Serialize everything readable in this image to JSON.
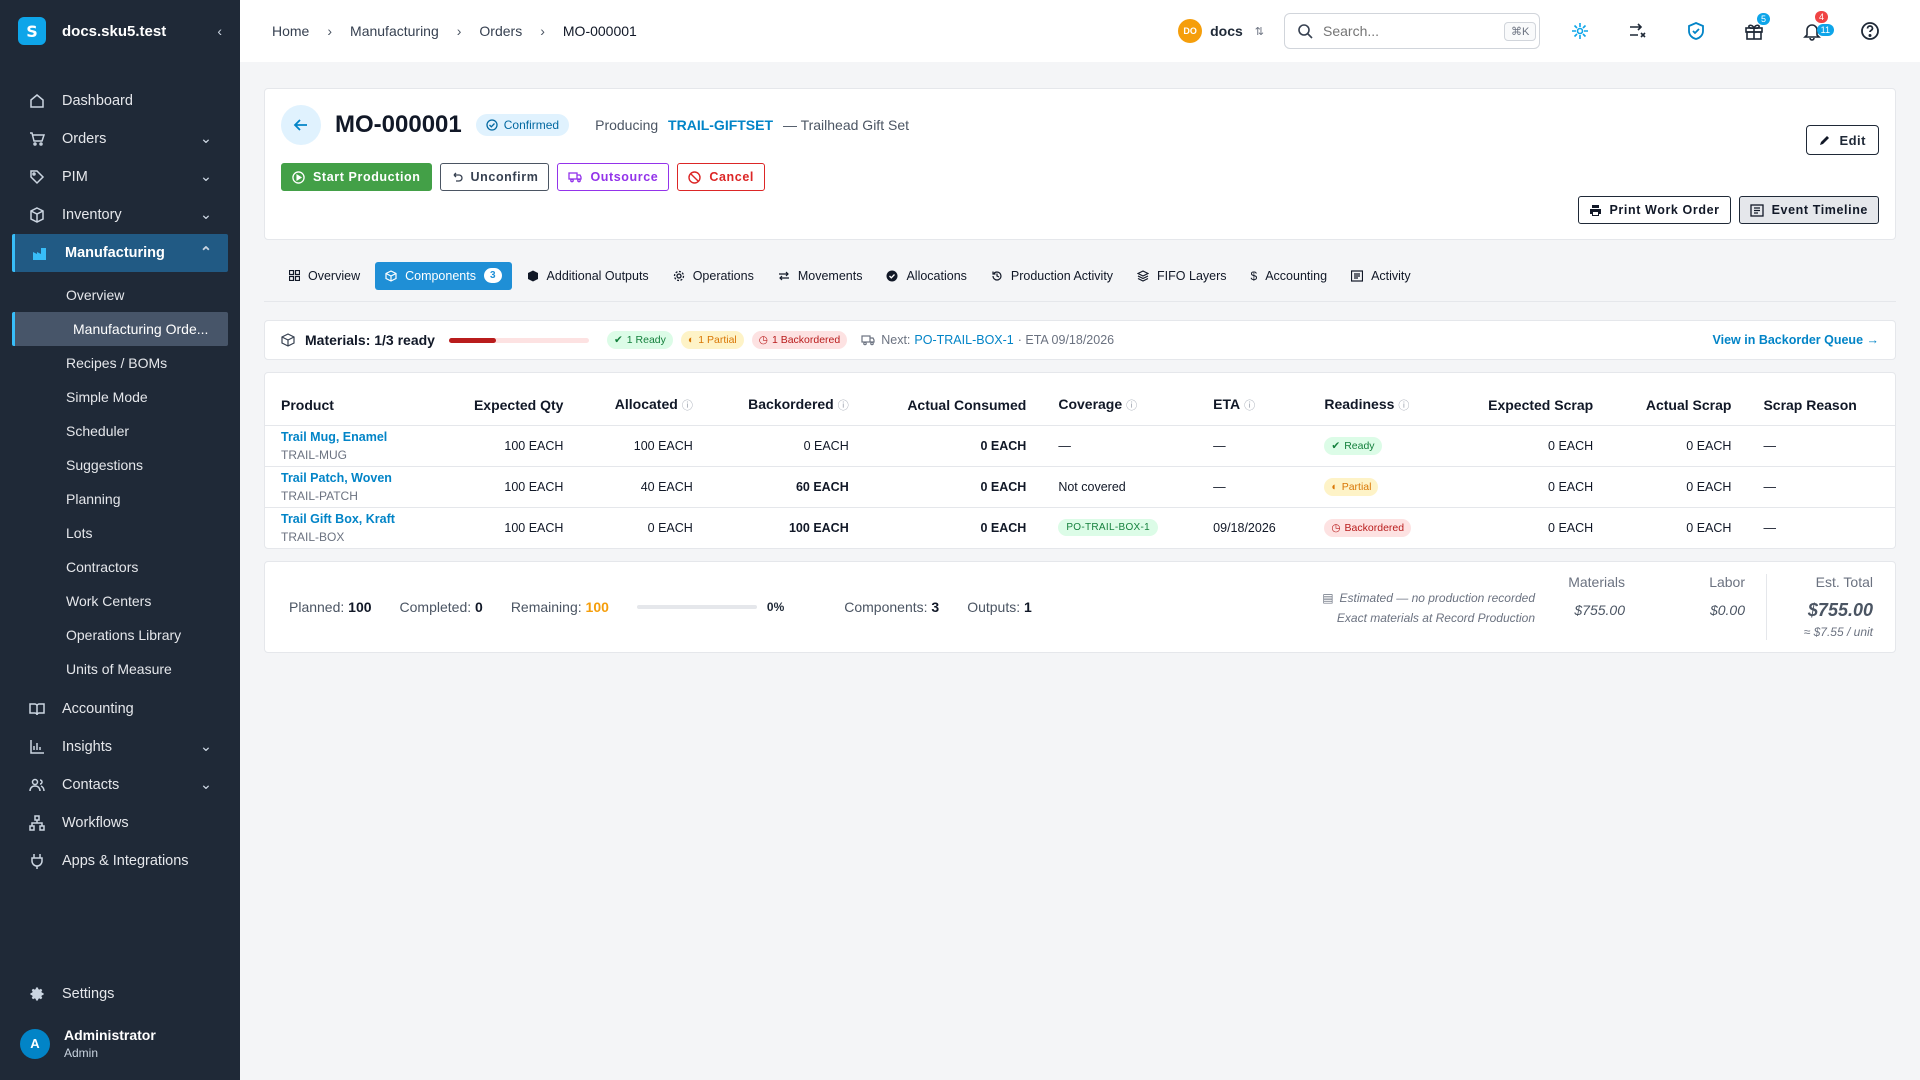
{
  "brand": {
    "name": "docs.sku5.test"
  },
  "sidebar": {
    "items": [
      {
        "label": "Dashboard"
      },
      {
        "label": "Orders"
      },
      {
        "label": "PIM"
      },
      {
        "label": "Inventory"
      },
      {
        "label": "Manufacturing"
      },
      {
        "label": "Accounting"
      },
      {
        "label": "Insights"
      },
      {
        "label": "Contacts"
      },
      {
        "label": "Workflows"
      },
      {
        "label": "Apps & Integrations"
      }
    ],
    "sub_items": [
      {
        "label": "Overview"
      },
      {
        "label": "Manufacturing Orde..."
      },
      {
        "label": "Recipes / BOMs"
      },
      {
        "label": "Simple Mode"
      },
      {
        "label": "Scheduler"
      },
      {
        "label": "Suggestions"
      },
      {
        "label": "Planning"
      },
      {
        "label": "Lots"
      },
      {
        "label": "Contractors"
      },
      {
        "label": "Work Centers"
      },
      {
        "label": "Operations Library"
      },
      {
        "label": "Units of Measure"
      }
    ],
    "settings_label": "Settings",
    "user": {
      "initial": "A",
      "name": "Administrator",
      "role": "Admin"
    }
  },
  "topbar": {
    "breadcrumbs": [
      "Home",
      "Manufacturing",
      "Orders",
      "MO-000001"
    ],
    "org": {
      "initials": "DO",
      "name": "docs"
    },
    "search": {
      "placeholder": "Search...",
      "shortcut": "⌘K"
    },
    "badges": {
      "gift": "5",
      "notif_red": "4",
      "notif_blue": "11"
    }
  },
  "header": {
    "title": "MO-000001",
    "status": "Confirmed",
    "producing_label": "Producing",
    "sku": "TRAIL-GIFTSET",
    "product_name": "— Trailhead Gift Set",
    "edit_label": "Edit",
    "actions": {
      "start": "Start Production",
      "unconfirm": "Unconfirm",
      "outsource": "Outsource",
      "cancel": "Cancel",
      "print": "Print Work Order",
      "timeline": "Event Timeline"
    }
  },
  "tabs": [
    {
      "label": "Overview"
    },
    {
      "label": "Components",
      "count": "3"
    },
    {
      "label": "Additional Outputs"
    },
    {
      "label": "Operations"
    },
    {
      "label": "Movements"
    },
    {
      "label": "Allocations"
    },
    {
      "label": "Production Activity"
    },
    {
      "label": "FIFO Layers"
    },
    {
      "label": "Accounting"
    },
    {
      "label": "Activity"
    }
  ],
  "materials": {
    "label": "Materials: 1/3 ready",
    "ready_fraction": 0.333,
    "chips": {
      "ready": "1 Ready",
      "partial": "1 Partial",
      "backordered": "1 Backordered"
    },
    "next_label": "Next:",
    "next_po": "PO-TRAIL-BOX-1",
    "next_eta": "· ETA 09/18/2026",
    "view_link": "View in Backorder Queue →"
  },
  "table": {
    "columns": [
      "Product",
      "Expected Qty",
      "Allocated",
      "Backordered",
      "Actual Consumed",
      "Coverage",
      "ETA",
      "Readiness",
      "Expected Scrap",
      "Actual Scrap",
      "Scrap Reason"
    ],
    "rows": [
      {
        "name": "Trail Mug, Enamel",
        "sku": "TRAIL-MUG",
        "expected": "100 EACH",
        "allocated": "100 EACH",
        "backordered": "0 EACH",
        "consumed": "0 EACH",
        "coverage": "—",
        "eta": "—",
        "readiness": "Ready",
        "exp_scrap": "0 EACH",
        "act_scrap": "0 EACH",
        "reason": "—"
      },
      {
        "name": "Trail Patch, Woven",
        "sku": "TRAIL-PATCH",
        "expected": "100 EACH",
        "allocated": "40 EACH",
        "backordered": "60 EACH",
        "consumed": "0 EACH",
        "coverage": "Not covered",
        "eta": "—",
        "readiness": "Partial",
        "exp_scrap": "0 EACH",
        "act_scrap": "0 EACH",
        "reason": "—"
      },
      {
        "name": "Trail Gift Box, Kraft",
        "sku": "TRAIL-BOX",
        "expected": "100 EACH",
        "allocated": "0 EACH",
        "backordered": "100 EACH",
        "consumed": "0 EACH",
        "coverage": "PO-TRAIL-BOX-1",
        "eta": "09/18/2026",
        "readiness": "Backordered",
        "exp_scrap": "0 EACH",
        "act_scrap": "0 EACH",
        "reason": "—"
      }
    ]
  },
  "summary": {
    "planned_label": "Planned:",
    "planned": "100",
    "completed_label": "Completed:",
    "completed": "0",
    "remaining_label": "Remaining:",
    "remaining": "100",
    "progress_pct": "0%",
    "components_label": "Components:",
    "components": "3",
    "outputs_label": "Outputs:",
    "outputs": "1",
    "estimate_line1": "Estimated — no production recorded",
    "estimate_line2": "Exact materials at Record Production",
    "materials_label": "Materials",
    "materials_value": "$755.00",
    "labor_label": "Labor",
    "labor_value": "$0.00",
    "total_label": "Est. Total",
    "total_value": "$755.00",
    "per_unit": "≈ $7.55 / unit"
  },
  "colors": {
    "accent": "#1f8fd6",
    "sidebar": "#1f2937",
    "primary_green": "#43a047",
    "danger": "#dc2626",
    "warning": "#f59e0b"
  }
}
